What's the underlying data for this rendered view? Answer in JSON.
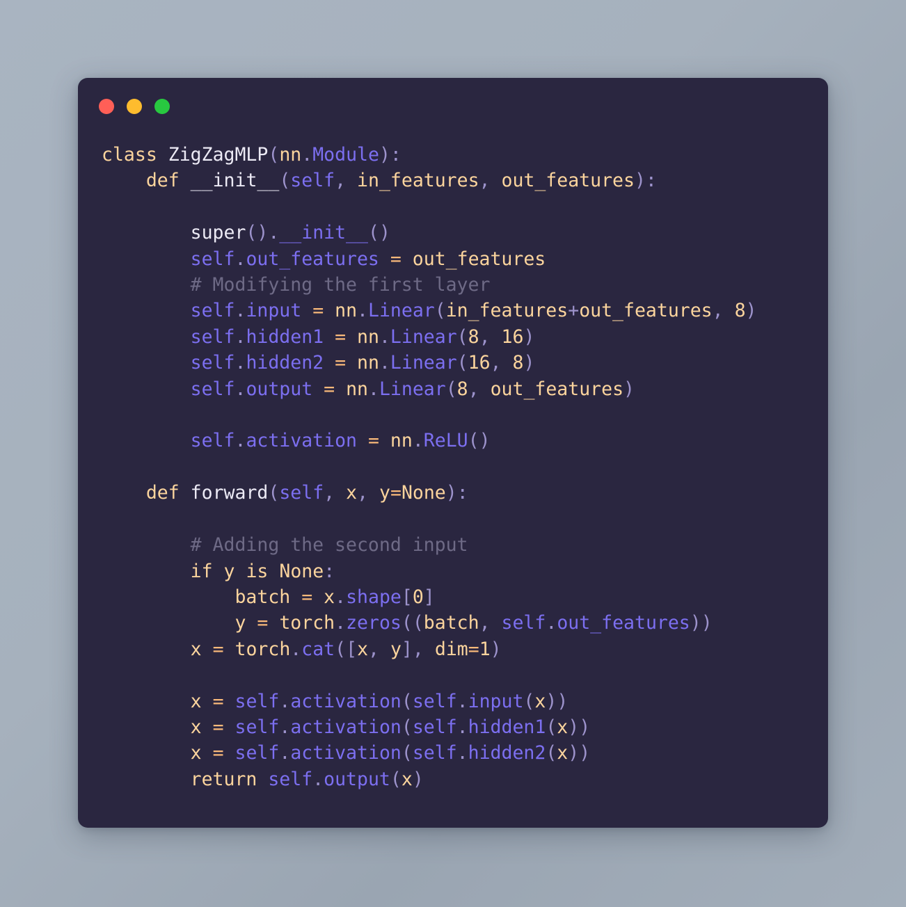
{
  "window": {
    "background_color": "#a7b2bf",
    "panel_color": "#2a2640",
    "traffic_lights": [
      {
        "name": "close",
        "label": "Close",
        "color": "#ff5f57"
      },
      {
        "name": "minimize",
        "label": "Minimize",
        "color": "#febc2e"
      },
      {
        "name": "maximize",
        "label": "Maximize",
        "color": "#28c840"
      }
    ]
  },
  "theme": {
    "keyword": "#fbd49d",
    "definition_name": "#eceaf5",
    "attribute": "#7c6ff0",
    "variable": "#fbd49d",
    "number": "#fbd49d",
    "operator": "#f9b97a",
    "punctuation": "#9d93cc",
    "comment": "#6e6a86"
  },
  "code": {
    "language": "python",
    "plain_text": "class ZigZagMLP(nn.Module):\n    def __init__(self, in_features, out_features):\n\n        super().__init__()\n        self.out_features = out_features\n        # Modifying the first layer\n        self.input = nn.Linear(in_features+out_features, 8)\n        self.hidden1 = nn.Linear(8, 16)\n        self.hidden2 = nn.Linear(16, 8)\n        self.output = nn.Linear(8, out_features)\n\n        self.activation = nn.ReLU()\n\n    def forward(self, x, y=None):\n\n        # Adding the second input\n        if y is None:\n            batch = x.shape[0]\n            y = torch.zeros((batch, self.out_features))\n        x = torch.cat([x, y], dim=1)\n\n        x = self.activation(self.input(x))\n        x = self.activation(self.hidden1(x))\n        x = self.activation(self.hidden2(x))\n        return self.output(x)",
    "lines": [
      "class ZigZagMLP(nn.Module):",
      "    def __init__(self, in_features, out_features):",
      "",
      "        super().__init__()",
      "        self.out_features = out_features",
      "        # Modifying the first layer",
      "        self.input = nn.Linear(in_features+out_features, 8)",
      "        self.hidden1 = nn.Linear(8, 16)",
      "        self.hidden2 = nn.Linear(16, 8)",
      "        self.output = nn.Linear(8, out_features)",
      "",
      "        self.activation = nn.ReLU()",
      "",
      "    def forward(self, x, y=None):",
      "",
      "        # Adding the second input",
      "        if y is None:",
      "            batch = x.shape[0]",
      "            y = torch.zeros((batch, self.out_features))",
      "        x = torch.cat([x, y], dim=1)",
      "",
      "        x = self.activation(self.input(x))",
      "        x = self.activation(self.hidden1(x))",
      "        x = self.activation(self.hidden2(x))",
      "        return self.output(x)"
    ],
    "class_name": "ZigZagMLP",
    "base_class": "nn.Module",
    "comments": [
      "# Modifying the first layer",
      "# Adding the second input"
    ],
    "methods": [
      "__init__",
      "forward"
    ],
    "layers": [
      {
        "name": "self.input",
        "module": "nn.Linear",
        "args": "in_features+out_features, 8"
      },
      {
        "name": "self.hidden1",
        "module": "nn.Linear",
        "args": "8, 16"
      },
      {
        "name": "self.hidden2",
        "module": "nn.Linear",
        "args": "16, 8"
      },
      {
        "name": "self.output",
        "module": "nn.Linear",
        "args": "8, out_features"
      },
      {
        "name": "self.activation",
        "module": "nn.ReLU",
        "args": ""
      }
    ]
  }
}
